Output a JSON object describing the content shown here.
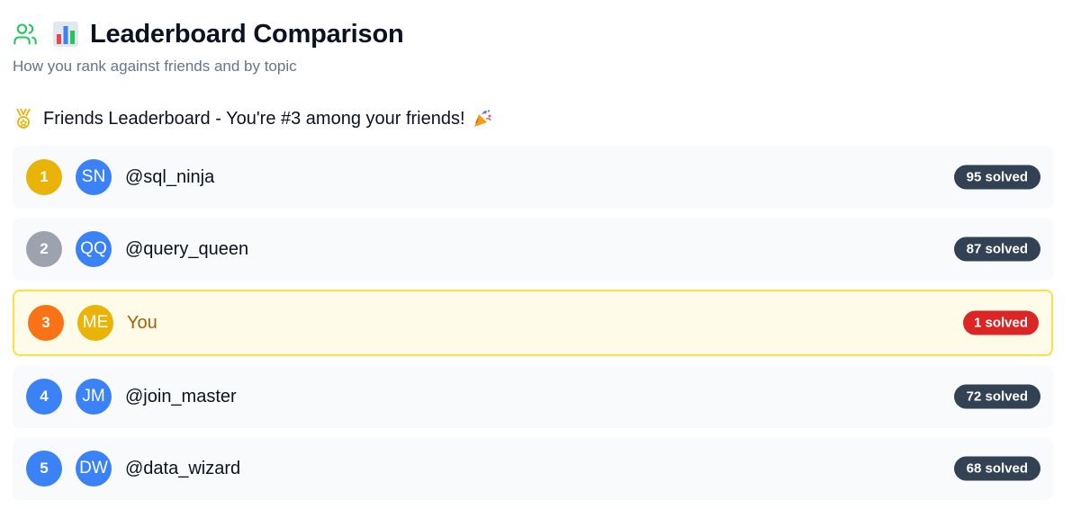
{
  "header": {
    "title": "Leaderboard Comparison",
    "subtitle": "How you rank against friends and by topic",
    "icons": [
      "users-icon",
      "bar-chart-emoji"
    ]
  },
  "friends_section": {
    "heading": "Friends Leaderboard - You're #3 among your friends!",
    "icons": [
      "medal-icon",
      "party-popper-emoji"
    ]
  },
  "colors": {
    "gold": "#eab308",
    "silver": "#9ca3af",
    "bronze": "#f97316",
    "blue": "#3b82f6",
    "highlight_bg": "#fefce8",
    "highlight_border": "#fde047",
    "badge_dark": "#334155",
    "badge_red": "#dc2626"
  },
  "leaderboard": [
    {
      "rank": "1",
      "initials": "SN",
      "name": "@sql_ninja",
      "solved": "95 solved",
      "rank_color": "#eab308",
      "avatar_color": "#3b82f6",
      "is_me": false
    },
    {
      "rank": "2",
      "initials": "QQ",
      "name": "@query_queen",
      "solved": "87 solved",
      "rank_color": "#9ca3af",
      "avatar_color": "#3b82f6",
      "is_me": false
    },
    {
      "rank": "3",
      "initials": "ME",
      "name": "You",
      "solved": "1 solved",
      "rank_color": "#f97316",
      "avatar_color": "#eab308",
      "is_me": true
    },
    {
      "rank": "4",
      "initials": "JM",
      "name": "@join_master",
      "solved": "72 solved",
      "rank_color": "#3b82f6",
      "avatar_color": "#3b82f6",
      "is_me": false
    },
    {
      "rank": "5",
      "initials": "DW",
      "name": "@data_wizard",
      "solved": "68 solved",
      "rank_color": "#3b82f6",
      "avatar_color": "#3b82f6",
      "is_me": false
    }
  ]
}
